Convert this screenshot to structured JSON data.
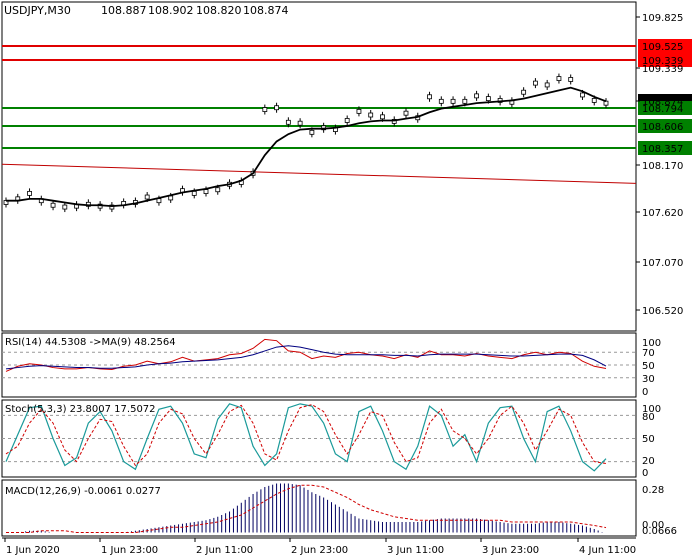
{
  "chart_data": {
    "type": "line",
    "symbol_timeframe": "USDJPY,M30",
    "ohlc": {
      "open": "108.887",
      "high": "108.902",
      "low": "108.820",
      "close": "108.874"
    },
    "x_tick_labels": [
      "1 Jun 2020",
      "1 Jun 23:00",
      "2 Jun 11:00",
      "2 Jun 23:00",
      "3 Jun 11:00",
      "3 Jun 23:00",
      "4 Jun 11:00"
    ],
    "main": {
      "y_ticks": [
        "109.825",
        "109.339",
        "108.874",
        "108.170",
        "107.620",
        "107.070",
        "106.520"
      ],
      "ylim": [
        106.37,
        109.98
      ],
      "level_labels": [
        {
          "text": "109.525",
          "price": 109.525,
          "color": "#ff0000",
          "fg": "#ffffff",
          "line": "#e00000"
        },
        {
          "text": "109.339",
          "price": 109.339,
          "color": "#ff0000",
          "fg": "#ffffff",
          "line": "#e00000"
        },
        {
          "text": "108.874",
          "price": 108.874,
          "color": "#000000",
          "fg": "#ffffff",
          "line": null
        },
        {
          "text": "108.794",
          "price": 108.794,
          "color": "#008000",
          "fg": "#ffffff",
          "line": "#008000"
        },
        {
          "text": "108.606",
          "price": 108.606,
          "color": "#008000",
          "fg": "#ffffff",
          "line": "#008000"
        },
        {
          "text": "108.357",
          "price": 108.357,
          "color": "#008000",
          "fg": "#ffffff",
          "line": "#008000"
        }
      ],
      "trend_line": {
        "start": 108.2,
        "end": 107.99,
        "color": "#c00000"
      },
      "price": [
        107.78,
        107.82,
        107.88,
        107.8,
        107.75,
        107.73,
        107.74,
        107.76,
        107.74,
        107.73,
        107.77,
        107.78,
        107.84,
        107.8,
        107.83,
        107.91,
        107.88,
        107.9,
        107.92,
        107.98,
        108.0,
        108.1,
        108.8,
        108.82,
        108.66,
        108.65,
        108.55,
        108.6,
        108.58,
        108.68,
        108.78,
        108.74,
        108.72,
        108.67,
        108.76,
        108.71,
        108.94,
        108.89,
        108.89,
        108.89,
        108.95,
        108.92,
        108.9,
        108.88,
        108.99,
        109.09,
        109.07,
        109.14,
        109.13,
        108.96,
        108.9,
        108.87
      ],
      "ma": [
        107.8,
        107.8,
        107.82,
        107.82,
        107.8,
        107.78,
        107.76,
        107.75,
        107.75,
        107.74,
        107.75,
        107.77,
        107.8,
        107.83,
        107.86,
        107.89,
        107.91,
        107.93,
        107.96,
        107.98,
        108.02,
        108.1,
        108.3,
        108.45,
        108.53,
        108.58,
        108.59,
        108.59,
        108.6,
        108.62,
        108.65,
        108.67,
        108.68,
        108.68,
        108.7,
        108.72,
        108.77,
        108.81,
        108.83,
        108.85,
        108.87,
        108.88,
        108.89,
        108.9,
        108.92,
        108.95,
        108.98,
        109.01,
        109.04,
        109.0,
        108.94,
        108.89
      ],
      "price_color": "#000000",
      "ma_color": "#000000"
    },
    "rsi": {
      "label": "RSI(14) 44.5308 ->MA(9) 48.2564",
      "y_ticks": [
        "100",
        "70",
        "50",
        "30",
        "0"
      ],
      "ylim": [
        0,
        100
      ],
      "levels": [
        70,
        50,
        30
      ],
      "rsi": [
        40,
        48,
        52,
        50,
        46,
        44,
        44,
        46,
        44,
        43,
        48,
        50,
        56,
        52,
        55,
        62,
        56,
        58,
        60,
        66,
        68,
        76,
        90,
        88,
        72,
        70,
        60,
        64,
        62,
        68,
        70,
        66,
        64,
        60,
        66,
        62,
        72,
        66,
        66,
        64,
        68,
        64,
        62,
        60,
        66,
        70,
        66,
        70,
        68,
        56,
        48,
        44.5
      ],
      "ma": [
        44,
        46,
        48,
        49,
        48,
        47,
        46,
        46,
        45,
        45,
        46,
        47,
        50,
        52,
        53,
        55,
        56,
        57,
        58,
        60,
        62,
        66,
        72,
        78,
        80,
        78,
        74,
        70,
        67,
        66,
        66,
        66,
        66,
        65,
        65,
        64,
        66,
        67,
        67,
        67,
        67,
        66,
        65,
        64,
        64,
        65,
        66,
        67,
        67,
        65,
        58,
        48.3
      ],
      "rsi_color": "#d00000",
      "ma_color": "#000080"
    },
    "stoch": {
      "label": "Stoch(5,3,3) 23.8007 17.5072",
      "y_ticks": [
        "100",
        "80",
        "50",
        "20",
        "0"
      ],
      "ylim": [
        0,
        100
      ],
      "levels": [
        80,
        50,
        20
      ],
      "k": [
        20,
        55,
        90,
        92,
        50,
        15,
        25,
        70,
        85,
        60,
        20,
        10,
        50,
        88,
        92,
        70,
        30,
        25,
        75,
        95,
        90,
        40,
        15,
        30,
        90,
        95,
        92,
        70,
        30,
        20,
        85,
        92,
        60,
        20,
        10,
        40,
        92,
        80,
        40,
        55,
        20,
        70,
        90,
        92,
        50,
        20,
        85,
        92,
        60,
        20,
        8,
        23.8
      ],
      "d": [
        30,
        40,
        70,
        88,
        70,
        35,
        20,
        50,
        75,
        72,
        40,
        15,
        30,
        70,
        88,
        82,
        50,
        30,
        55,
        85,
        93,
        70,
        30,
        22,
        60,
        90,
        94,
        85,
        55,
        30,
        55,
        85,
        80,
        45,
        20,
        25,
        70,
        88,
        60,
        50,
        30,
        50,
        80,
        92,
        70,
        35,
        60,
        88,
        80,
        45,
        20,
        17.5
      ],
      "k_color": "#1a9a9a",
      "d_color": "#d00000"
    },
    "macd": {
      "label": "MACD(12,26,9) -0.0061 0.0277",
      "y_ticks": [
        "0.28",
        "0.00",
        "0.0666"
      ],
      "ylim": [
        -0.02,
        0.3
      ],
      "hist": [
        0.0,
        0.0,
        0.01,
        0.01,
        0.0,
        0.0,
        0.0,
        0.0,
        0.0,
        0.0,
        0.0,
        0.01,
        0.02,
        0.03,
        0.04,
        0.05,
        0.06,
        0.07,
        0.09,
        0.12,
        0.17,
        0.22,
        0.26,
        0.28,
        0.28,
        0.27,
        0.23,
        0.2,
        0.16,
        0.12,
        0.08,
        0.07,
        0.06,
        0.06,
        0.06,
        0.06,
        0.07,
        0.08,
        0.08,
        0.08,
        0.08,
        0.07,
        0.06,
        0.05,
        0.05,
        0.05,
        0.06,
        0.06,
        0.05,
        0.04,
        0.02,
        -0.006
      ],
      "signal": [
        0.0,
        0.0,
        0.0,
        0.01,
        0.01,
        0.01,
        0.0,
        0.0,
        0.0,
        0.0,
        0.0,
        0.0,
        0.01,
        0.02,
        0.03,
        0.03,
        0.04,
        0.05,
        0.06,
        0.08,
        0.1,
        0.14,
        0.18,
        0.22,
        0.25,
        0.27,
        0.27,
        0.26,
        0.23,
        0.2,
        0.16,
        0.13,
        0.11,
        0.09,
        0.08,
        0.07,
        0.07,
        0.07,
        0.07,
        0.07,
        0.07,
        0.07,
        0.07,
        0.06,
        0.06,
        0.06,
        0.06,
        0.06,
        0.06,
        0.05,
        0.04,
        0.028
      ],
      "hist_color": "#000060",
      "signal_color": "#d00000"
    },
    "grid": false,
    "legend": "top-left"
  }
}
